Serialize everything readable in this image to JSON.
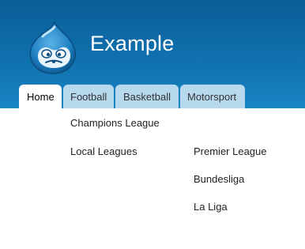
{
  "site": {
    "name": "Example",
    "header_gradient": [
      "#0a5d97",
      "#1a86c4"
    ],
    "logo_icon": "drupal-drop-logo"
  },
  "nav": {
    "tabs": [
      {
        "label": "Home",
        "active": true
      },
      {
        "label": "Football",
        "active": false
      },
      {
        "label": "Basketball",
        "active": false
      },
      {
        "label": "Motorsport",
        "active": false
      }
    ],
    "tab_color": "#b7d9ee"
  },
  "dropdown": {
    "parent": "Football",
    "items": [
      {
        "label": "Champions League"
      },
      {
        "label": "Local Leagues",
        "children": [
          {
            "label": "Premier League"
          },
          {
            "label": "Bundesliga"
          },
          {
            "label": "La Liga"
          }
        ]
      }
    ]
  }
}
